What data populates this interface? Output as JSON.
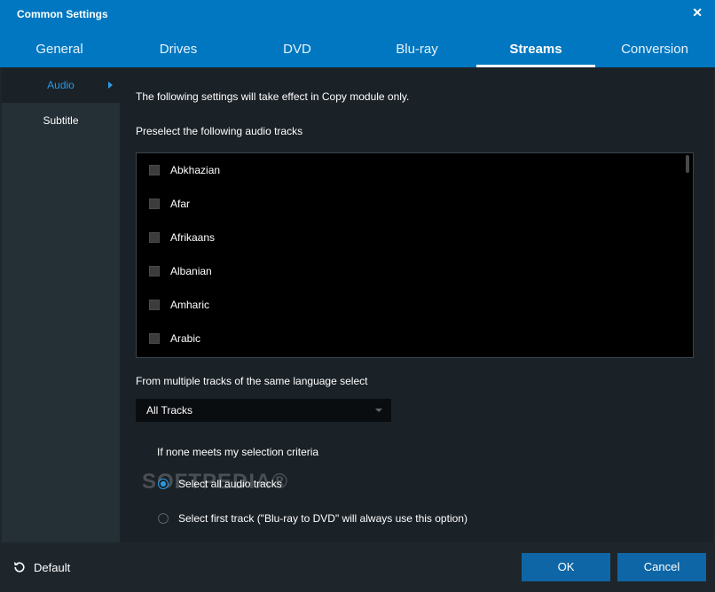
{
  "window": {
    "title": "Common Settings",
    "close_glyph": "✕"
  },
  "tabs": [
    {
      "label": "General"
    },
    {
      "label": "Drives"
    },
    {
      "label": "DVD"
    },
    {
      "label": "Blu-ray"
    },
    {
      "label": "Streams",
      "active": true
    },
    {
      "label": "Conversion"
    }
  ],
  "sidebar": {
    "items": [
      {
        "label": "Audio",
        "active": true
      },
      {
        "label": "Subtitle"
      }
    ]
  },
  "content": {
    "note": "The following settings will take effect in Copy module only.",
    "preselect_label": "Preselect the following audio tracks",
    "languages": [
      "Abkhazian",
      "Afar",
      "Afrikaans",
      "Albanian",
      "Amharic",
      "Arabic"
    ],
    "multiple_label": "From multiple tracks of the same language select",
    "dropdown": {
      "value": "All Tracks"
    },
    "none_meets_label": "If none meets my selection criteria",
    "radio": [
      {
        "label": "Select all audio tracks",
        "checked": true
      },
      {
        "label": "Select first track (\"Blu-ray to DVD\" will always use this option)",
        "checked": false
      }
    ],
    "watermark": "SOFTPEDIA®"
  },
  "footer": {
    "default_label": "Default",
    "ok_label": "OK",
    "cancel_label": "Cancel"
  },
  "colors": {
    "titlebar": "#0077c0",
    "accent": "#2a9ae5",
    "button": "#0e66a6"
  }
}
